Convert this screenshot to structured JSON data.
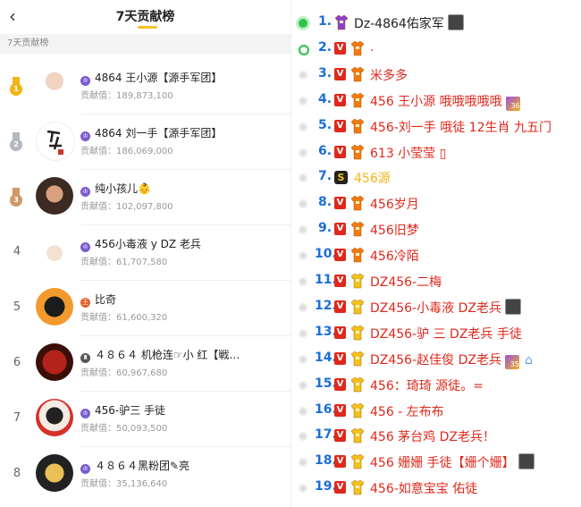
{
  "left": {
    "back_glyph": "‹",
    "title": "7天贡献榜",
    "subtitle": "7天贡献榜",
    "value_label": "贡献值：",
    "rows": [
      {
        "rank": "1",
        "badge_color": "#7a5ccf",
        "badge_glyph": "♔",
        "name": "4864 王小源【源手军团】",
        "value": "189,873,100",
        "medal_color": "#f2b518"
      },
      {
        "rank": "2",
        "badge_color": "#7a5ccf",
        "badge_glyph": "♔",
        "name": "4864 刘一手【源手军团】",
        "value": "186,069,000",
        "medal_color": "#b3b8c2"
      },
      {
        "rank": "3",
        "badge_color": "#7a5ccf",
        "badge_glyph": "♔",
        "name": "纯小孩儿👶",
        "value": "102,097,800",
        "medal_color": "#cf9867"
      },
      {
        "rank": "4",
        "badge_color": "#7a5ccf",
        "badge_glyph": "♔",
        "name": "456小毒液 y DZ 老兵",
        "value": "61,707,580"
      },
      {
        "rank": "5",
        "badge_color": "#e0602a",
        "badge_glyph": "王",
        "name": "比奇",
        "value": "61,600,320"
      },
      {
        "rank": "6",
        "badge_color": "#555555",
        "badge_glyph": "♜",
        "name": "４８６４ 机枪连☞小 红【戦…",
        "value": "60,967,680"
      },
      {
        "rank": "7",
        "badge_color": "#7a5ccf",
        "badge_glyph": "♔",
        "name": "456-驴三 手徒",
        "value": "50,093,500"
      },
      {
        "rank": "8",
        "badge_color": "#7a5ccf",
        "badge_glyph": "♔",
        "name": "４８６４黑粉团✎亮",
        "value": "35,136,640"
      }
    ]
  },
  "right": {
    "rows": [
      {
        "num": "1.",
        "v": false,
        "gift": "purple",
        "text": "Dz-4864佑家军",
        "text_color": "#222222",
        "tag": "white",
        "dot": "on"
      },
      {
        "num": "2.",
        "v": true,
        "gift": "orange",
        "text": ".",
        "text_color": "#e0281c",
        "dot": "on2"
      },
      {
        "num": "3.",
        "v": true,
        "gift": "orange",
        "text": "米多多",
        "text_color": "#e0281c"
      },
      {
        "num": "4.",
        "v": true,
        "gift": "orange",
        "text": "456 王小源 哦哦哦哦哦",
        "text_color": "#e0281c",
        "tag": "purple",
        "tag_text": "36"
      },
      {
        "num": "5.",
        "v": true,
        "gift": "orange",
        "text": "456-刘一手 哦徒 12生肖 九五门",
        "text_color": "#e0281c"
      },
      {
        "num": "6.",
        "v": true,
        "gift": "orange",
        "text": "613 小莹莹 ▯",
        "text_color": "#e0281c"
      },
      {
        "num": "7.",
        "v": false,
        "gift": "s",
        "text": "456源",
        "text_color": "#f2b518"
      },
      {
        "num": "8.",
        "v": true,
        "gift": "orange",
        "text": "456岁月",
        "text_color": "#e0281c"
      },
      {
        "num": "9.",
        "v": true,
        "gift": "orange",
        "text": "456旧梦",
        "text_color": "#e0281c"
      },
      {
        "num": "10.",
        "v": true,
        "gift": "orange",
        "text": "456冷陌",
        "text_color": "#e0281c"
      },
      {
        "num": "11.",
        "v": true,
        "gift": "yellow",
        "text": "DZ456-二梅",
        "text_color": "#e0281c"
      },
      {
        "num": "12.",
        "v": true,
        "gift": "yellow",
        "text": "DZ456-小毒液 DZ老兵",
        "text_color": "#e0281c",
        "tag": "white"
      },
      {
        "num": "13.",
        "v": true,
        "gift": "yellow",
        "text": "DZ456-驴 三 DZ老兵 手徒",
        "text_color": "#e0281c"
      },
      {
        "num": "14.",
        "v": true,
        "gift": "yellow",
        "text": "DZ456-赵佳俊 DZ老兵",
        "text_color": "#e0281c",
        "tag": "purple",
        "tag_text": "35",
        "extra": "⌂"
      },
      {
        "num": "15.",
        "v": true,
        "gift": "yellow",
        "text": "456：琦琦 源徒。=",
        "text_color": "#e0281c"
      },
      {
        "num": "16.",
        "v": true,
        "gift": "yellow",
        "text": "456 - 左布布",
        "text_color": "#e0281c"
      },
      {
        "num": "17.",
        "v": true,
        "gift": "yellow",
        "text": "456 茅台鸡  DZ老兵！",
        "text_color": "#e0281c"
      },
      {
        "num": "18.",
        "v": true,
        "gift": "yellow",
        "text": "456 姗姗 手徒【姗个姗】",
        "text_color": "#e0281c",
        "tag": "white"
      },
      {
        "num": "19.",
        "v": true,
        "gift": "yellow",
        "text": "456-如意宝宝 佑徒",
        "text_color": "#e0281c"
      }
    ]
  }
}
